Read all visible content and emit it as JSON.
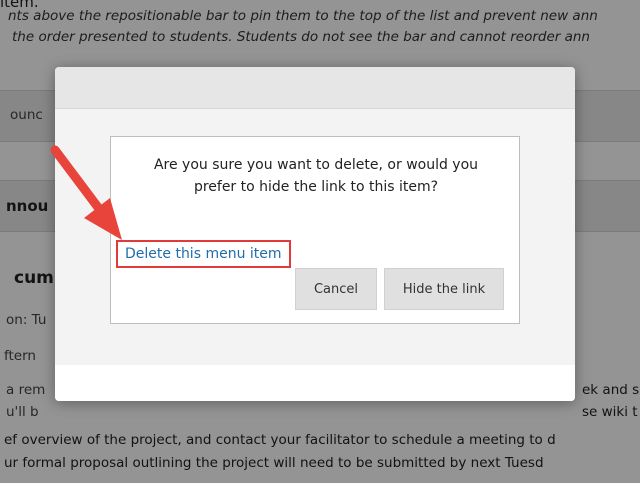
{
  "background": {
    "top_fragment": "item.",
    "intro_line1": "nts above the repositionable bar to pin them to the top of the list and prevent new ann",
    "intro_line2": "the order presented to students. Students do not see the bar and cannot reorder ann",
    "band1_text": "ounc",
    "band2_heading": "nnou",
    "section_heading": "cum",
    "meta_line": "on: Tu",
    "sub_line": "ftern",
    "body_left1": "a rem",
    "body_left2": "u'll b",
    "body_right1": "ek and s",
    "body_right2": "se wiki t",
    "body_line3": "ef overview of the project, and contact your facilitator to schedule a meeting to d",
    "body_line4": "ur formal proposal outlining the project will need to be submitted by next Tuesd"
  },
  "dialog": {
    "message": "Are you sure you want to delete, or would you prefer to hide the link to this item?",
    "delete_link": "Delete this menu item",
    "cancel_label": "Cancel",
    "hide_label": "Hide the link"
  },
  "colors": {
    "link": "#1f6dac",
    "highlight_border": "#e03a3a",
    "arrow": "#e8443c"
  },
  "icons": {
    "annotation_arrow": "arrow-pointer-icon"
  }
}
